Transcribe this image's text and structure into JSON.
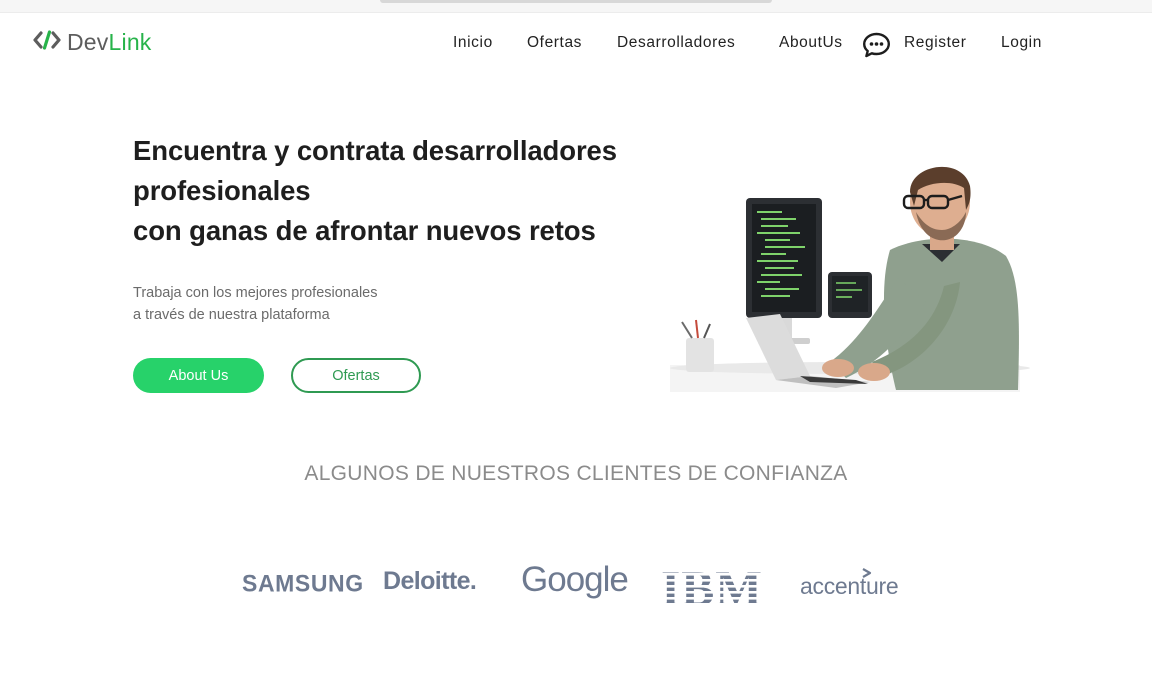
{
  "brand": {
    "name_part1": "Dev",
    "name_part2": "Link",
    "accent_color": "#27b34a",
    "logo_icon": "code-brackets-icon"
  },
  "nav": {
    "items": [
      "Inicio",
      "Ofertas",
      "Desarrolladores",
      "AboutUs"
    ],
    "chat_icon": "chat-bubble-icon",
    "register": "Register",
    "login": "Login"
  },
  "hero": {
    "title_lines": [
      "Encuentra y contrata desarrolladores",
      "profesionales",
      "con ganas de afrontar nuevos retos"
    ],
    "subtitle_lines": [
      "Trabaja con los mejores profesionales",
      "a través de nuestra plataforma"
    ],
    "primary_button": "About Us",
    "secondary_button": "Ofertas",
    "button_color": "#27d26a",
    "image": "developer-at-desk-illustration"
  },
  "clients": {
    "heading": "ALGUNOS DE NUESTROS CLIENTES DE CONFIANZA",
    "logos": [
      "SAMSUNG",
      "Deloitte.",
      "Google",
      "IBM",
      "accenture"
    ]
  }
}
